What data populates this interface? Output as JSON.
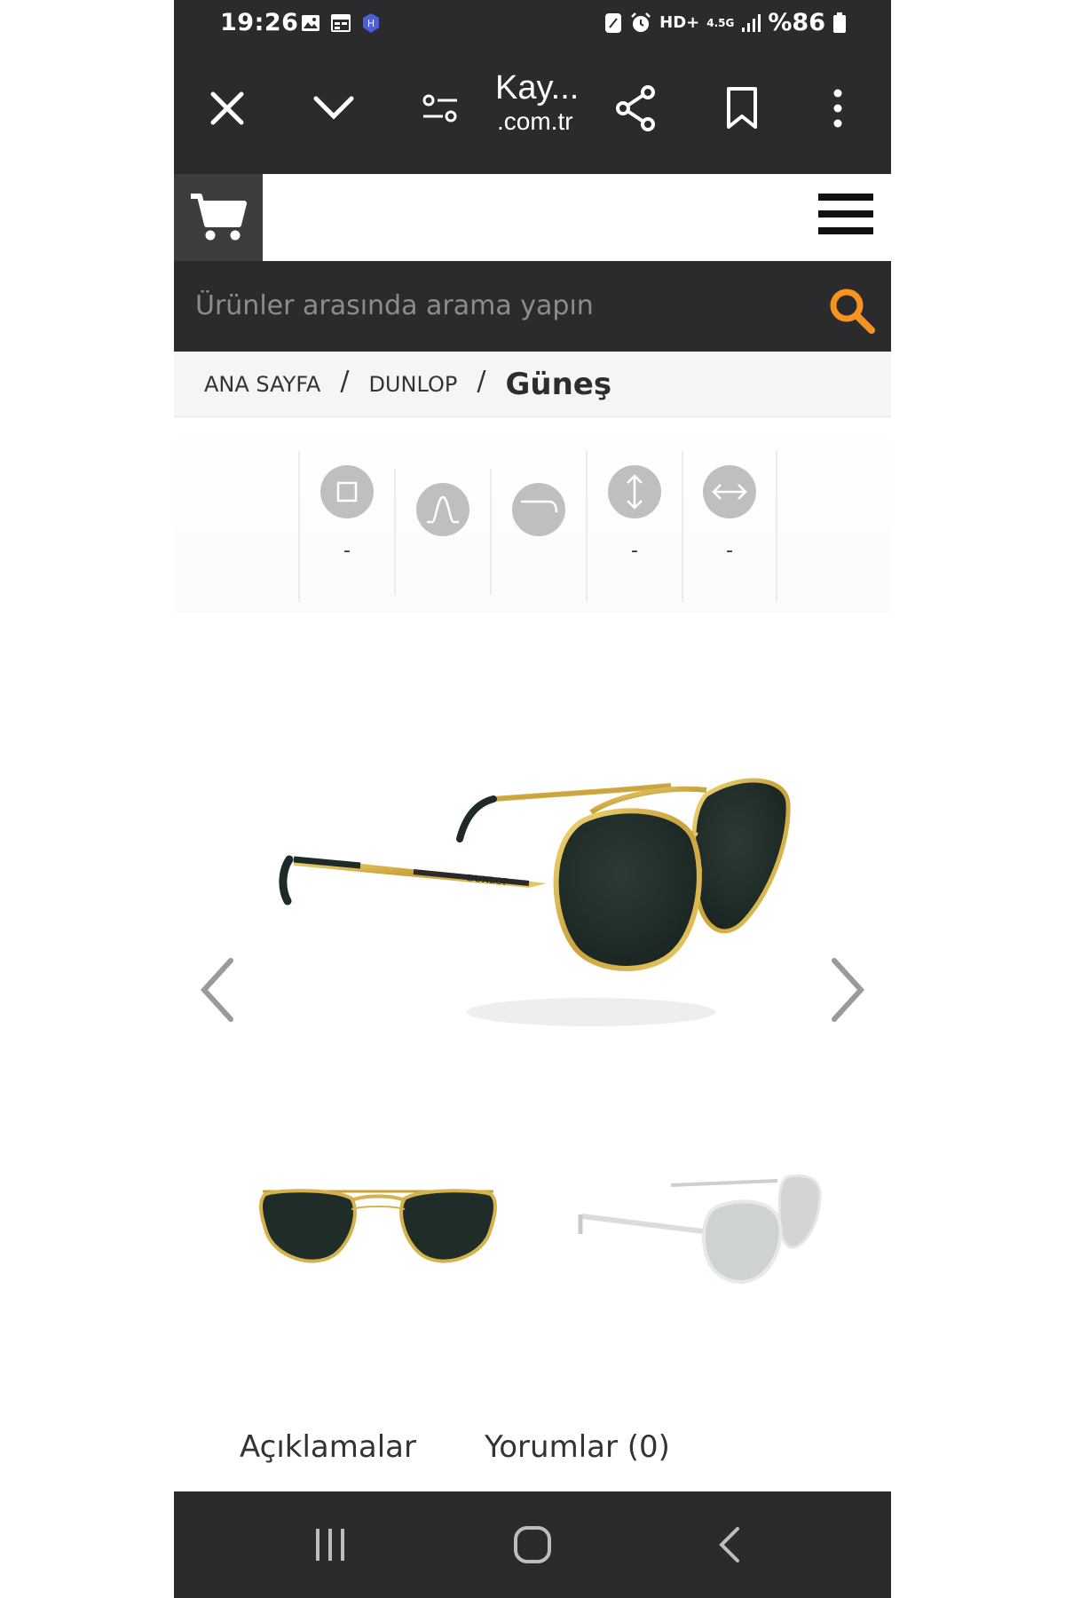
{
  "status_bar": {
    "time": "19:26",
    "network": "HD+",
    "network_type": "4.5G",
    "battery": "%86",
    "left_icons": [
      "gallery-icon",
      "calendar-icon",
      "shield-app-icon"
    ],
    "right_icons": [
      "nfc-icon",
      "alarm-icon",
      "signal-icon",
      "battery-icon"
    ]
  },
  "browser": {
    "title": "Kay...",
    "domain": ".com.tr",
    "buttons": [
      "close-icon",
      "chevron-down-icon",
      "site-settings-icon",
      "share-icon",
      "bookmark-icon",
      "more-vert-icon"
    ]
  },
  "search": {
    "placeholder": "Ürünler arasında arama yapın",
    "accent_color": "#f7931e"
  },
  "breadcrumb": {
    "home": "ANA SAYFA",
    "brand": "DUNLOP",
    "current": "Güneş",
    "separator": "/"
  },
  "specs": [
    {
      "icon": "frame-size-icon",
      "value": "-"
    },
    {
      "icon": "bridge-icon",
      "value": ""
    },
    {
      "icon": "temple-icon",
      "value": ""
    },
    {
      "icon": "height-icon",
      "value": "-"
    },
    {
      "icon": "width-icon",
      "value": "-"
    }
  ],
  "product": {
    "brand_engraving": "DUNLOP",
    "frame_color": "#d4b24c",
    "lens_color": "#23302c"
  },
  "tabs": {
    "descriptions": "Açıklamalar",
    "reviews": "Yorumlar (0)"
  },
  "nav": [
    "recent-apps-icon",
    "home-icon",
    "back-icon"
  ]
}
